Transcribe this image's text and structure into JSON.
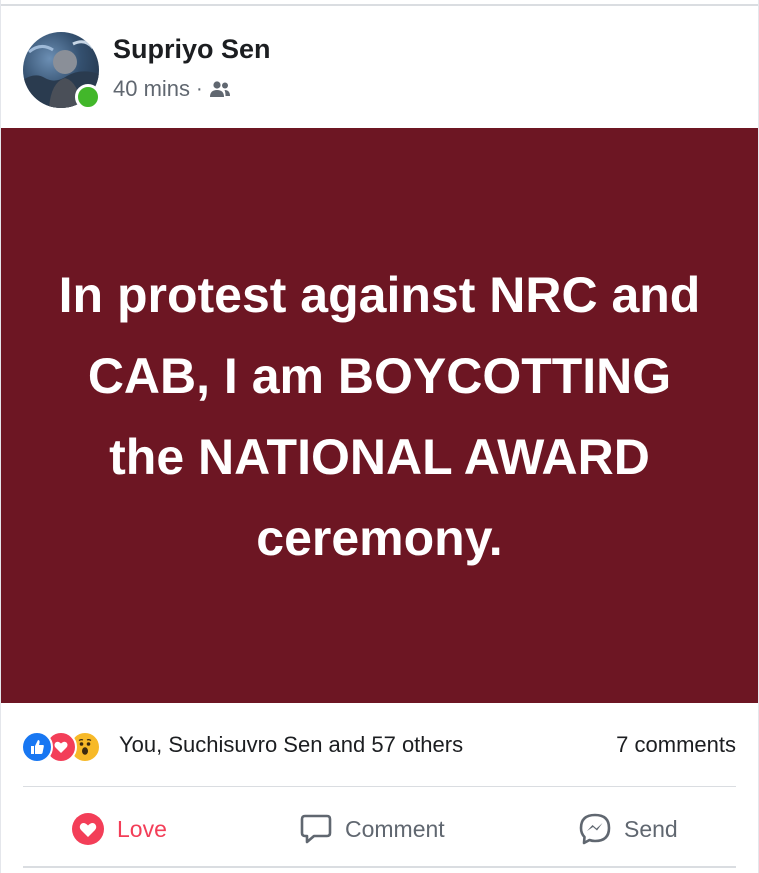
{
  "post": {
    "author": "Supriyo Sen",
    "time": "40 mins",
    "separator": "·",
    "audience_icon": "friends-icon",
    "text": "In protest against NRC and CAB, I am BOYCOTTING the NATIONAL AWARD ceremony.",
    "background_color": "#6d1623"
  },
  "engagement": {
    "reaction_icons": [
      "like-icon",
      "love-icon",
      "wow-icon"
    ],
    "reactions_summary": "You, Suchisuvro Sen and 57 others",
    "comments_count": "7 comments"
  },
  "actions": {
    "love_label": "Love",
    "comment_label": "Comment",
    "send_label": "Send"
  },
  "colors": {
    "love_accent": "#f33e58",
    "like_blue": "#1877f2",
    "online_green": "#42b72a"
  }
}
